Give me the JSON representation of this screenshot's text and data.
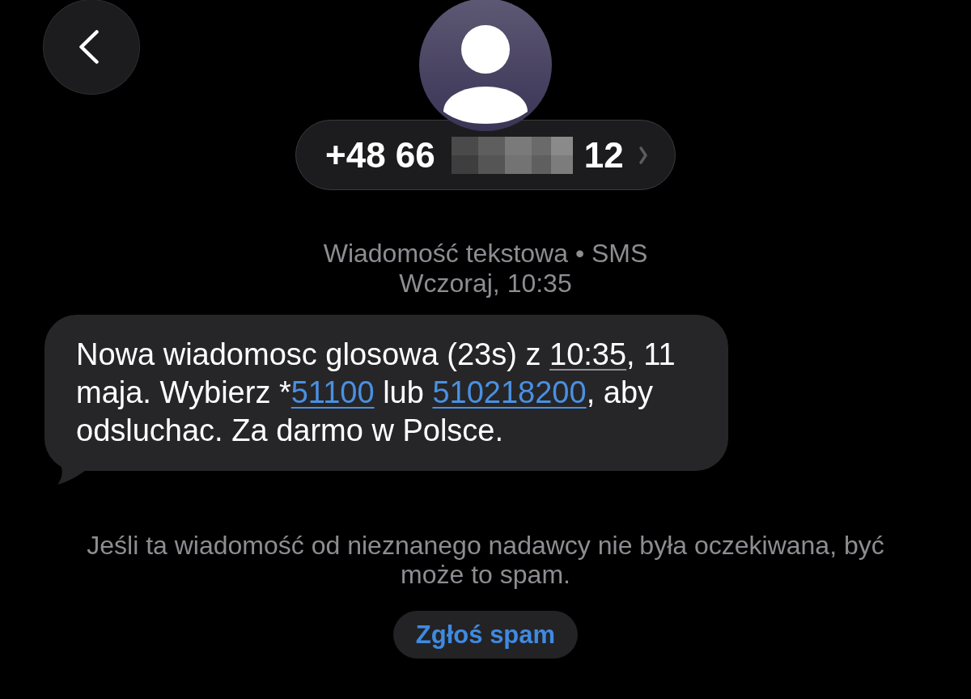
{
  "contact": {
    "number_start": "+48 66",
    "redacted": true,
    "number_end": "12"
  },
  "meta": {
    "service": "Wiadomość tekstowa • SMS",
    "time": "Wczoraj, 10:35"
  },
  "message": {
    "segments": [
      {
        "kind": "text",
        "text": "Nowa wiadomosc glosowa (23s) z "
      },
      {
        "kind": "time",
        "text": "10:35"
      },
      {
        "kind": "text",
        "text": ", 11 maja. Wybierz *"
      },
      {
        "kind": "link",
        "text": "51100"
      },
      {
        "kind": "text",
        "text": " lub "
      },
      {
        "kind": "link",
        "text": "510218200"
      },
      {
        "kind": "text",
        "text": ", aby odsluchac. Za darmo w Polsce."
      }
    ]
  },
  "spam_notice": "Jeśli ta wiadomość od nieznanego nadawcy nie była oczekiwana, być może to spam.",
  "report_button": "Zgłoś spam"
}
